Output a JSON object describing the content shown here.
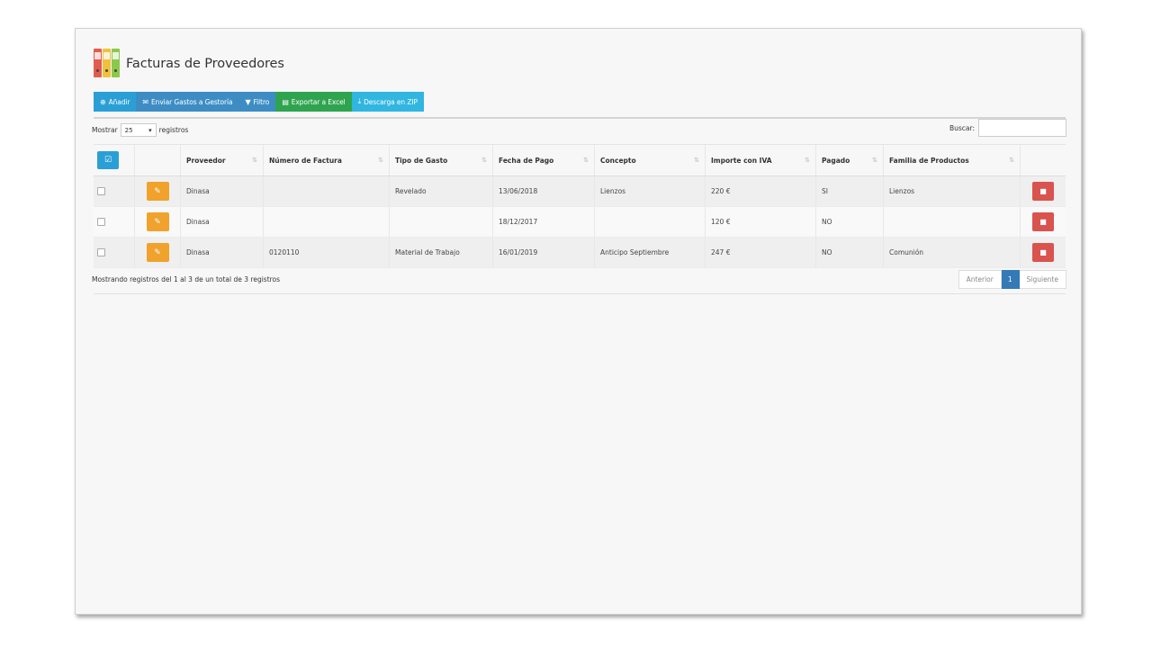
{
  "page": {
    "title": "Facturas de Proveedores",
    "icon": "binders-icon",
    "icon_colors": [
      "#e25b4f",
      "#f0c23b",
      "#8cc84b"
    ]
  },
  "toolbar": {
    "add": {
      "label": "Añadir",
      "icon": "plus-circle-icon",
      "color": "#2a9fd6"
    },
    "send": {
      "label": "Enviar Gastos a Gestoría",
      "icon": "envelope-icon",
      "color": "#3d8dc4"
    },
    "filter": {
      "label": "Filtro",
      "icon": "filter-icon",
      "color": "#3d8dc4"
    },
    "export": {
      "label": "Exportar a Excel",
      "icon": "file-icon",
      "color": "#2fa44f"
    },
    "zip": {
      "label": "Descarga en ZIP",
      "icon": "download-icon",
      "color": "#30b6e0"
    }
  },
  "length": {
    "prefix": "Mostrar",
    "value": "25",
    "suffix": "registros"
  },
  "search": {
    "label": "Buscar:",
    "value": ""
  },
  "table": {
    "columns": {
      "proveedor": "Proveedor",
      "numero": "Número de Factura",
      "tipo": "Tipo de Gasto",
      "fecha": "Fecha de Pago",
      "concepto": "Concepto",
      "importe": "Importe con IVA",
      "pagado": "Pagado",
      "familia": "Familia de Productos"
    },
    "rows": [
      {
        "proveedor": "Dinasa",
        "numero": "",
        "tipo": "Revelado",
        "fecha": "13/06/2018",
        "concepto": "Lienzos",
        "importe": "220 €",
        "pagado": "SI",
        "familia": "Lienzos"
      },
      {
        "proveedor": "Dinasa",
        "numero": "",
        "tipo": "",
        "fecha": "18/12/2017",
        "concepto": "",
        "importe": "120 €",
        "pagado": "NO",
        "familia": ""
      },
      {
        "proveedor": "Dinasa",
        "numero": "0120110",
        "tipo": "Material de Trabajo",
        "fecha": "16/01/2019",
        "concepto": "Anticipo Septiembre",
        "importe": "247 €",
        "pagado": "NO",
        "familia": "Comunión"
      }
    ]
  },
  "info": "Mostrando registros del 1 al 3 de un total de 3 registros",
  "pagination": {
    "prev": "Anterior",
    "current": "1",
    "next": "Siguiente",
    "active_color": "#337ab7"
  }
}
